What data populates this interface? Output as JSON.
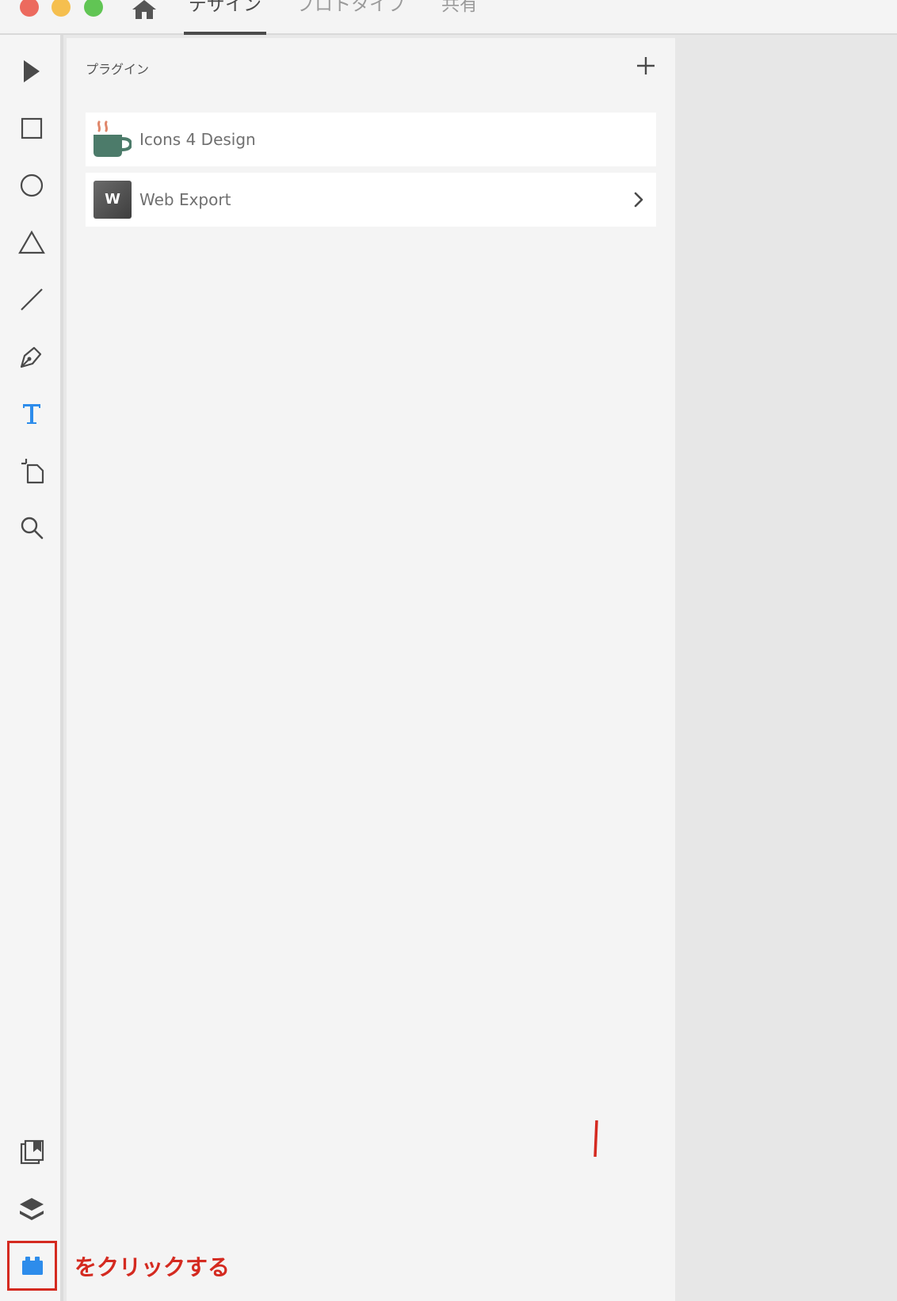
{
  "window": {
    "tabs": [
      {
        "label": "デザイン",
        "active": true
      },
      {
        "label": "プロトタイプ",
        "active": false
      },
      {
        "label": "共有",
        "active": false
      }
    ]
  },
  "toolbar": {
    "tools": [
      "select-icon",
      "rectangle-icon",
      "ellipse-icon",
      "polygon-icon",
      "line-icon",
      "pen-icon",
      "text-icon",
      "artboard-icon",
      "zoom-icon"
    ],
    "bottom_tools": [
      "assets-icon",
      "layers-icon",
      "plugins-icon"
    ]
  },
  "panel": {
    "title": "プラグイン",
    "plugins": [
      {
        "label": "Icons 4 Design",
        "icon": "coffee-cup-icon"
      },
      {
        "label": "Web Export",
        "icon": "w-badge-icon",
        "badge": "W"
      }
    ]
  },
  "annotation": {
    "text": "をクリックする",
    "color": "#d42a20"
  },
  "colors": {
    "accent": "#2d8ceb",
    "annotation_red": "#d42a20"
  }
}
